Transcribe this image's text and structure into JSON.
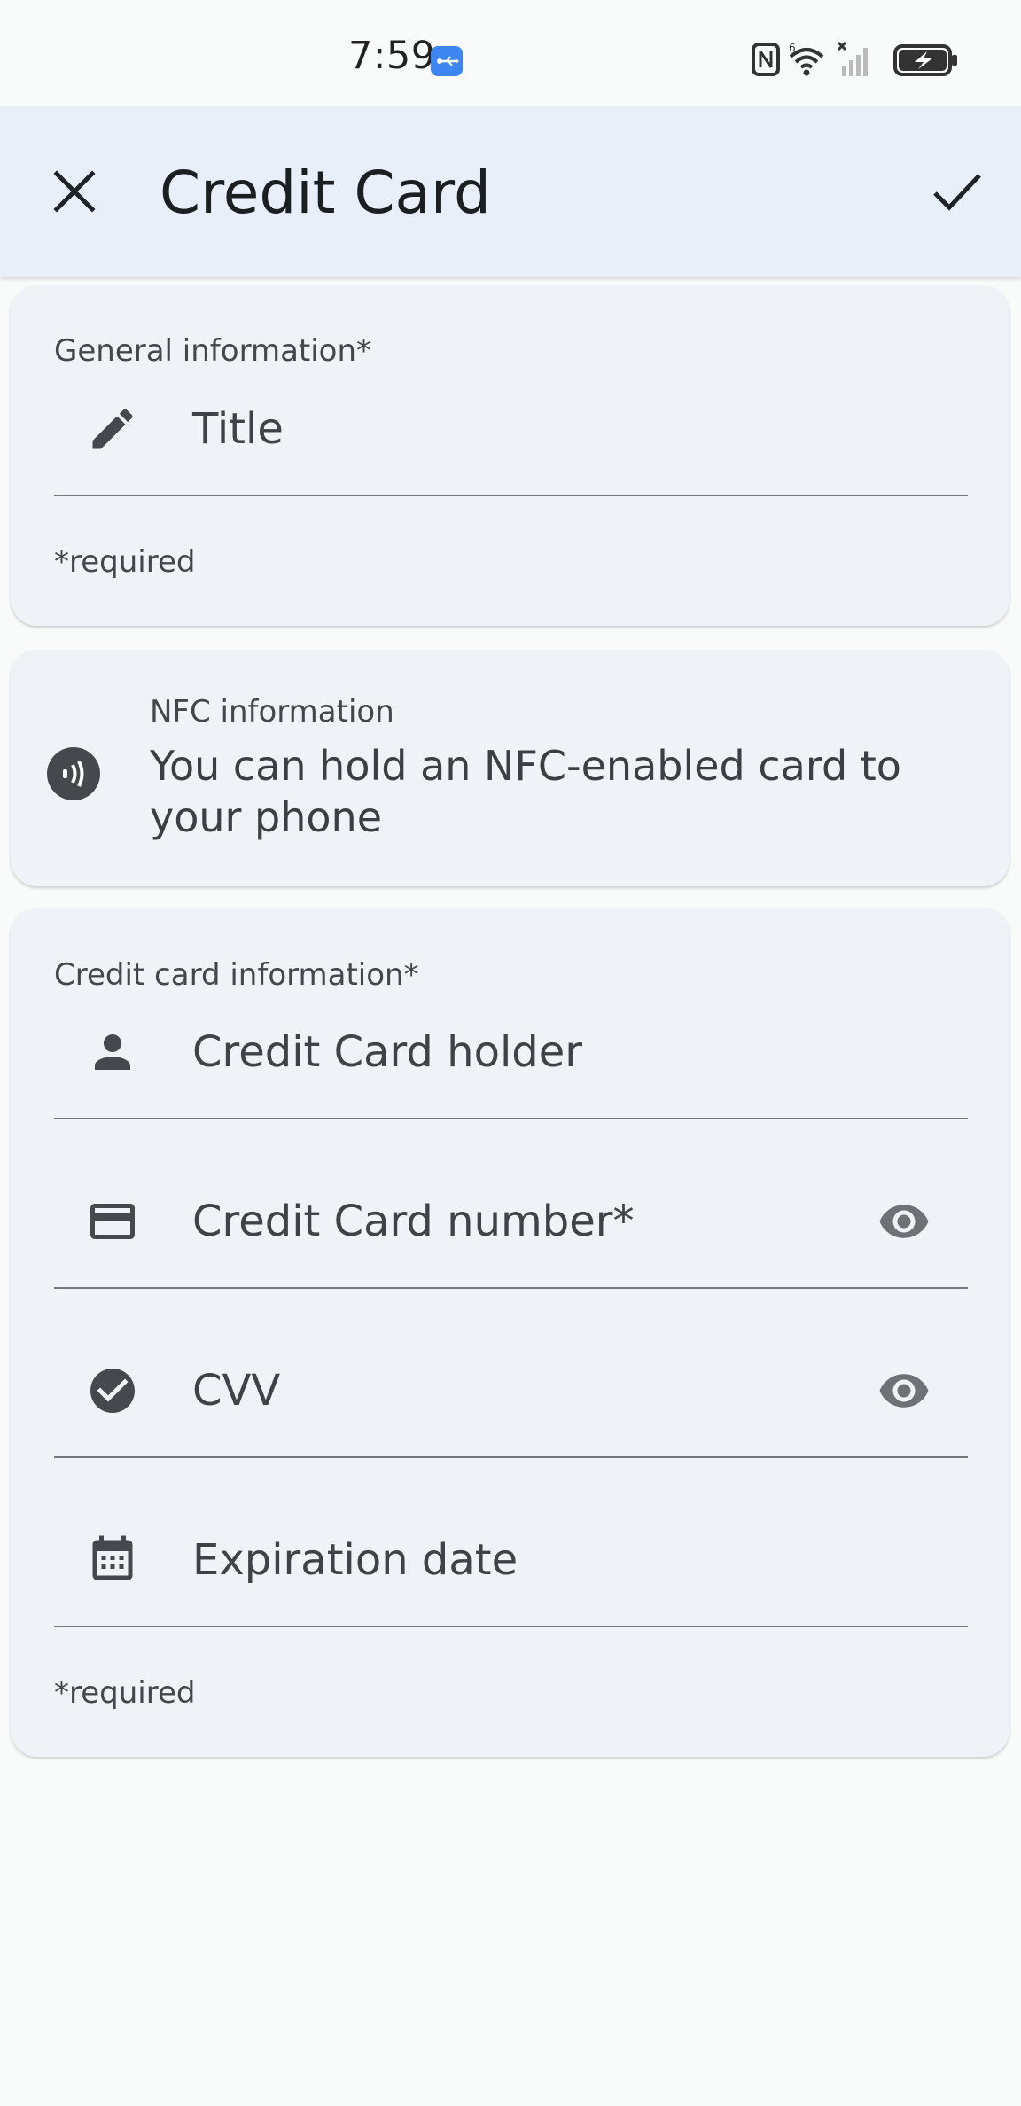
{
  "status_bar": {
    "time": "7:59"
  },
  "app_bar": {
    "title": "Credit Card",
    "close_icon": "close-icon",
    "save_icon": "check-icon"
  },
  "general_section": {
    "label": "General information*",
    "title_field": {
      "label": "Title",
      "icon": "pencil-icon"
    },
    "required_note": "*required"
  },
  "nfc_section": {
    "label": "NFC information",
    "message": "You can hold an NFC-enabled card to your phone",
    "icon": "nfc-icon"
  },
  "credit_card_section": {
    "label": "Credit card information*",
    "fields": [
      {
        "label": "Credit Card holder",
        "icon": "person-icon"
      },
      {
        "label": "Credit Card number*",
        "icon": "credit-card-icon",
        "trailing_icon": "eye-icon"
      },
      {
        "label": "CVV",
        "icon": "check-circle-icon",
        "trailing_icon": "eye-icon"
      },
      {
        "label": "Expiration date",
        "icon": "calendar-icon"
      }
    ],
    "required_note": "*required"
  },
  "colors": {
    "app_bar_bg": "#e8eff8",
    "card_bg": "#eff3f8",
    "page_bg": "#f9fbfa",
    "icon": "#45494d",
    "usb_badge": "#3d86f2"
  }
}
